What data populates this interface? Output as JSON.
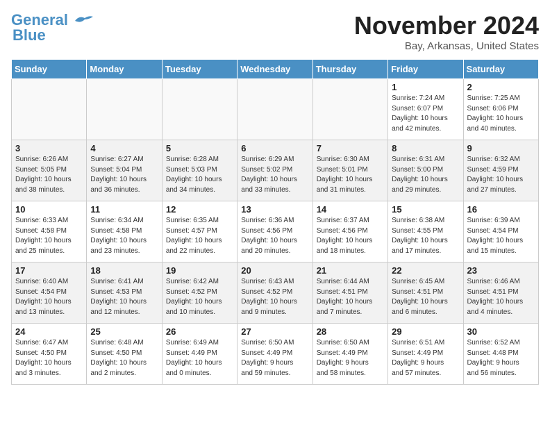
{
  "logo": {
    "line1": "General",
    "line2": "Blue"
  },
  "title": "November 2024",
  "location": "Bay, Arkansas, United States",
  "weekdays": [
    "Sunday",
    "Monday",
    "Tuesday",
    "Wednesday",
    "Thursday",
    "Friday",
    "Saturday"
  ],
  "weeks": [
    [
      {
        "day": "",
        "info": ""
      },
      {
        "day": "",
        "info": ""
      },
      {
        "day": "",
        "info": ""
      },
      {
        "day": "",
        "info": ""
      },
      {
        "day": "",
        "info": ""
      },
      {
        "day": "1",
        "info": "Sunrise: 7:24 AM\nSunset: 6:07 PM\nDaylight: 10 hours\nand 42 minutes."
      },
      {
        "day": "2",
        "info": "Sunrise: 7:25 AM\nSunset: 6:06 PM\nDaylight: 10 hours\nand 40 minutes."
      }
    ],
    [
      {
        "day": "3",
        "info": "Sunrise: 6:26 AM\nSunset: 5:05 PM\nDaylight: 10 hours\nand 38 minutes."
      },
      {
        "day": "4",
        "info": "Sunrise: 6:27 AM\nSunset: 5:04 PM\nDaylight: 10 hours\nand 36 minutes."
      },
      {
        "day": "5",
        "info": "Sunrise: 6:28 AM\nSunset: 5:03 PM\nDaylight: 10 hours\nand 34 minutes."
      },
      {
        "day": "6",
        "info": "Sunrise: 6:29 AM\nSunset: 5:02 PM\nDaylight: 10 hours\nand 33 minutes."
      },
      {
        "day": "7",
        "info": "Sunrise: 6:30 AM\nSunset: 5:01 PM\nDaylight: 10 hours\nand 31 minutes."
      },
      {
        "day": "8",
        "info": "Sunrise: 6:31 AM\nSunset: 5:00 PM\nDaylight: 10 hours\nand 29 minutes."
      },
      {
        "day": "9",
        "info": "Sunrise: 6:32 AM\nSunset: 4:59 PM\nDaylight: 10 hours\nand 27 minutes."
      }
    ],
    [
      {
        "day": "10",
        "info": "Sunrise: 6:33 AM\nSunset: 4:58 PM\nDaylight: 10 hours\nand 25 minutes."
      },
      {
        "day": "11",
        "info": "Sunrise: 6:34 AM\nSunset: 4:58 PM\nDaylight: 10 hours\nand 23 minutes."
      },
      {
        "day": "12",
        "info": "Sunrise: 6:35 AM\nSunset: 4:57 PM\nDaylight: 10 hours\nand 22 minutes."
      },
      {
        "day": "13",
        "info": "Sunrise: 6:36 AM\nSunset: 4:56 PM\nDaylight: 10 hours\nand 20 minutes."
      },
      {
        "day": "14",
        "info": "Sunrise: 6:37 AM\nSunset: 4:56 PM\nDaylight: 10 hours\nand 18 minutes."
      },
      {
        "day": "15",
        "info": "Sunrise: 6:38 AM\nSunset: 4:55 PM\nDaylight: 10 hours\nand 17 minutes."
      },
      {
        "day": "16",
        "info": "Sunrise: 6:39 AM\nSunset: 4:54 PM\nDaylight: 10 hours\nand 15 minutes."
      }
    ],
    [
      {
        "day": "17",
        "info": "Sunrise: 6:40 AM\nSunset: 4:54 PM\nDaylight: 10 hours\nand 13 minutes."
      },
      {
        "day": "18",
        "info": "Sunrise: 6:41 AM\nSunset: 4:53 PM\nDaylight: 10 hours\nand 12 minutes."
      },
      {
        "day": "19",
        "info": "Sunrise: 6:42 AM\nSunset: 4:52 PM\nDaylight: 10 hours\nand 10 minutes."
      },
      {
        "day": "20",
        "info": "Sunrise: 6:43 AM\nSunset: 4:52 PM\nDaylight: 10 hours\nand 9 minutes."
      },
      {
        "day": "21",
        "info": "Sunrise: 6:44 AM\nSunset: 4:51 PM\nDaylight: 10 hours\nand 7 minutes."
      },
      {
        "day": "22",
        "info": "Sunrise: 6:45 AM\nSunset: 4:51 PM\nDaylight: 10 hours\nand 6 minutes."
      },
      {
        "day": "23",
        "info": "Sunrise: 6:46 AM\nSunset: 4:51 PM\nDaylight: 10 hours\nand 4 minutes."
      }
    ],
    [
      {
        "day": "24",
        "info": "Sunrise: 6:47 AM\nSunset: 4:50 PM\nDaylight: 10 hours\nand 3 minutes."
      },
      {
        "day": "25",
        "info": "Sunrise: 6:48 AM\nSunset: 4:50 PM\nDaylight: 10 hours\nand 2 minutes."
      },
      {
        "day": "26",
        "info": "Sunrise: 6:49 AM\nSunset: 4:49 PM\nDaylight: 10 hours\nand 0 minutes."
      },
      {
        "day": "27",
        "info": "Sunrise: 6:50 AM\nSunset: 4:49 PM\nDaylight: 9 hours\nand 59 minutes."
      },
      {
        "day": "28",
        "info": "Sunrise: 6:50 AM\nSunset: 4:49 PM\nDaylight: 9 hours\nand 58 minutes."
      },
      {
        "day": "29",
        "info": "Sunrise: 6:51 AM\nSunset: 4:49 PM\nDaylight: 9 hours\nand 57 minutes."
      },
      {
        "day": "30",
        "info": "Sunrise: 6:52 AM\nSunset: 4:48 PM\nDaylight: 9 hours\nand 56 minutes."
      }
    ]
  ]
}
